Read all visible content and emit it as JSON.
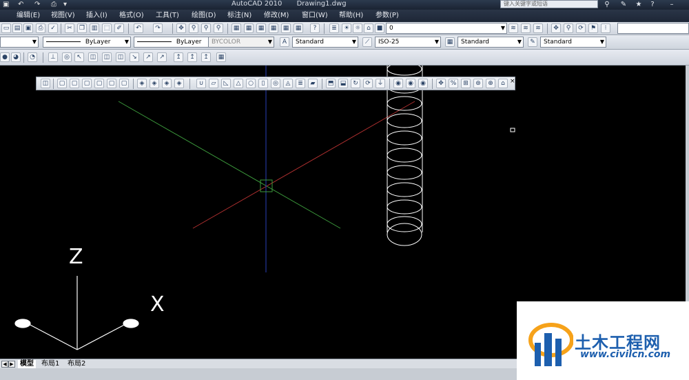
{
  "window": {
    "app_title": "AutoCAD 2010",
    "doc_title": "Drawing1.dwg",
    "search_placeholder": "键入关键字或短语"
  },
  "menu": [
    "编辑(E)",
    "视图(V)",
    "插入(I)",
    "格式(O)",
    "工具(T)",
    "绘图(D)",
    "标注(N)",
    "修改(M)",
    "窗口(W)",
    "帮助(H)",
    "参数(P)"
  ],
  "layer": {
    "current": "0"
  },
  "properties": {
    "color": "ByLayer",
    "linetype": "ByLayer",
    "plotstyle": "BYCOLOR"
  },
  "styles": {
    "text": "Standard",
    "dimension": "ISO-25",
    "table": "Standard",
    "multileader": "Standard"
  },
  "float_toolbar": {
    "close": "×"
  },
  "ucs": {
    "z_label": "Z",
    "x_label": "X"
  },
  "tabs": {
    "model": "模型",
    "layout1": "布局1",
    "layout2": "布局2"
  },
  "watermark": {
    "name": "土木工程网",
    "url": "www.civilcn.com"
  },
  "colors": {
    "axis_green": "#3c9a3c",
    "axis_red": "#b03030",
    "axis_blue": "#2a3fb8",
    "drawing_bg": "#000000",
    "brand_blue": "#1d5fae"
  },
  "icons": {
    "quick_access": [
      "undo-icon",
      "redo-icon",
      "print-icon"
    ],
    "titlebar_right": [
      "binoculars-icon",
      "key-icon",
      "star-icon",
      "help-icon"
    ]
  }
}
